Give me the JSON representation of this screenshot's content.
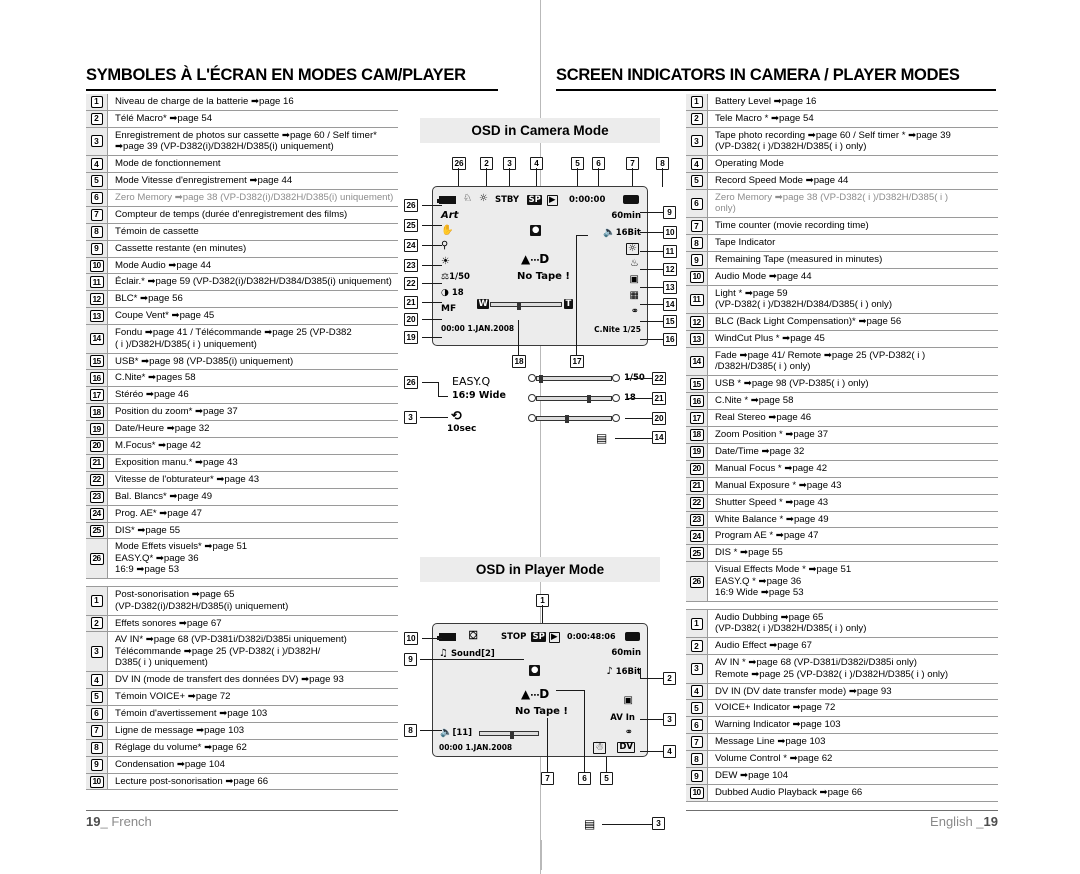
{
  "headers": {
    "french": "SYMBOLES À L'ÉCRAN EN MODES CAM/PLAYER",
    "english": "SCREEN INDICATORS IN CAMERA / PLAYER MODES"
  },
  "footer": {
    "french": "19_ French",
    "french_num": "19",
    "french_label": "French",
    "english": "English _19",
    "english_label": "English",
    "english_num": "19"
  },
  "osd_panels": {
    "camera_title": "OSD in Camera Mode",
    "player_title": "OSD in Player Mode"
  },
  "camera_osd": {
    "top_row": {
      "battery": "battery-icon",
      "tele_macro": "tele-macro-icon",
      "photo": "photo-icon",
      "mode": "STBY",
      "record_speed": "SP",
      "play": "play-icon",
      "counter": "0:00:00",
      "tape": "tape-icon"
    },
    "left_side": [
      {
        "num": "26",
        "label": "Art"
      },
      {
        "num": "25",
        "label": "dis-hand-icon"
      },
      {
        "num": "24",
        "label": "program-ae-icon"
      },
      {
        "num": "23",
        "label": "white-balance-icon"
      },
      {
        "num": "22",
        "label": "1/50"
      },
      {
        "num": "21",
        "label": "18"
      },
      {
        "num": "20",
        "label": "MF"
      },
      {
        "num": "19",
        "label": "00:00  1.JAN.2008"
      }
    ],
    "right_side": [
      {
        "num": "9",
        "label": "60min"
      },
      {
        "num": "10",
        "label": "16Bit"
      },
      {
        "num": "11",
        "label": "blc-icon"
      },
      {
        "num": "12",
        "label": "windcut-icon"
      },
      {
        "num": "13",
        "label": "fade-icon"
      },
      {
        "num": "14",
        "label": "light-icon"
      },
      {
        "num": "15",
        "label": "usb-icon"
      },
      {
        "num": "16",
        "label": "C.Nite 1/25"
      }
    ],
    "center": {
      "rec_dot": "rec-icon",
      "eject": "eject-icon",
      "dv": "D",
      "no_tape": "No Tape !"
    },
    "zoom_bar": {
      "wide": "W",
      "tele": "T",
      "num": "18"
    },
    "volume_callout": "17"
  },
  "camera_extra": {
    "easyq_num": "26",
    "easyq": "EASY.Q",
    "wide": "16:9 Wide",
    "selftimer_num": "3",
    "selftimer": "10sec",
    "sliders": [
      {
        "num": "22",
        "value": "1/50"
      },
      {
        "num": "21",
        "value": "18"
      },
      {
        "num": "20",
        "value": ""
      }
    ],
    "light_num": "14"
  },
  "player_osd": {
    "top_row": {
      "battery": "battery-icon",
      "voice_plus": "voice-plus-icon",
      "mode": "STOP",
      "record_speed": "SP",
      "play": "play-icon",
      "counter": "0:00:48:06",
      "tape": "tape-icon"
    },
    "sound": "Sound[2]",
    "sound_num": "10",
    "rec_num": "9",
    "remaining": "60min",
    "audio_bit": "16Bit",
    "audio_bit_num": "2",
    "eject": "eject-icon",
    "dv": "D",
    "dv_num": "6",
    "no_tape": "No Tape !",
    "no_tape_num": "7",
    "fade_icon": "fade-icon",
    "av_in": "AV In",
    "av_in_num": "3",
    "usb_icon": "usb-icon",
    "dew_icon": "dew-icon",
    "dew_num": "5",
    "dv_in": "DV",
    "dv_in_num": "4",
    "volume": "[11]",
    "volume_num": "8",
    "datetime": "00:00  1.JAN.2008",
    "voice_num": "1",
    "light_icon_num": "3"
  },
  "french_list_camera": [
    {
      "num": "1",
      "text": "Niveau de charge de la batterie ➡page 16"
    },
    {
      "num": "2",
      "text": "Télé Macro* ➡page 54"
    },
    {
      "num": "3",
      "text": "Enregistrement de photos sur cassette ➡page 60 / Self timer*",
      "text2": "➡page 39 (VP-D382(i)/D382H/D385(i) uniquement)"
    },
    {
      "num": "4",
      "text": "Mode de fonctionnement"
    },
    {
      "num": "5",
      "text": "Mode Vitesse d'enregistrement ➡page 44"
    },
    {
      "num": "6",
      "text": "Zero Memory ➡page 38 (VP-D382(i)/D382H/D385(i) uniquement)",
      "dim": true
    },
    {
      "num": "7",
      "text": "Compteur de temps (durée d'enregistrement des films)"
    },
    {
      "num": "8",
      "text": "Témoin de cassette"
    },
    {
      "num": "9",
      "text": "Cassette restante (en minutes)"
    },
    {
      "num": "10",
      "text": "Mode Audio ➡page 44"
    },
    {
      "num": "11",
      "text": "Éclair.* ➡page 59  (VP-D382(i)/D382H/D384/D385(i) uniquement)"
    },
    {
      "num": "12",
      "text": "BLC* ➡page 56"
    },
    {
      "num": "13",
      "text": "Coupe Vent* ➡page 45"
    },
    {
      "num": "14",
      "text": "Fondu ➡page 41 / Télécommande ➡page 25 (VP-D382",
      "text2": "( i )/D382H/D385( i )  uniquement)"
    },
    {
      "num": "15",
      "text": "USB* ➡page 98 (VP-D385(i) uniquement)"
    },
    {
      "num": "16",
      "text": "C.Nite* ➡pages 58"
    },
    {
      "num": "17",
      "text": "Stéréo ➡page 46"
    },
    {
      "num": "18",
      "text": "Position du zoom* ➡page 37"
    },
    {
      "num": "19",
      "text": "Date/Heure ➡page 32"
    },
    {
      "num": "20",
      "text": "M.Focus* ➡page 42"
    },
    {
      "num": "21",
      "text": "Exposition manu.* ➡page 43"
    },
    {
      "num": "22",
      "text": "Vitesse de l'obturateur* ➡page 43"
    },
    {
      "num": "23",
      "text": "Bal. Blancs* ➡page 49"
    },
    {
      "num": "24",
      "text": "Prog. AE* ➡page 47"
    },
    {
      "num": "25",
      "text": "DIS* ➡page 55"
    },
    {
      "num": "26",
      "text": "Mode Effets visuels* ➡page 51",
      "text2": "EASY.Q* ➡page 36",
      "text3": "16:9 ➡page 53"
    }
  ],
  "french_list_player": [
    {
      "num": "1",
      "text": "Post-sonorisation ➡page 65",
      "text2": "(VP-D382(i)/D382H/D385(i) uniquement)"
    },
    {
      "num": "2",
      "text": "Effets sonores ➡page 67"
    },
    {
      "num": "3",
      "text": "AV IN* ➡page 68 (VP-D381i/D382i/D385i uniquement)",
      "text2": "Télécommande ➡page 25 (VP-D382( i )/D382H/",
      "text3": "D385( i )  uniquement)"
    },
    {
      "num": "4",
      "text": "DV IN (mode de transfert des données DV) ➡page 93"
    },
    {
      "num": "5",
      "text": "Témoin VOICE+ ➡page 72"
    },
    {
      "num": "6",
      "text": "Témoin d'avertissement ➡page 103"
    },
    {
      "num": "7",
      "text": "Ligne de message ➡page 103"
    },
    {
      "num": "8",
      "text": "Réglage du volume* ➡page 62"
    },
    {
      "num": "9",
      "text": "Condensation ➡page 104"
    },
    {
      "num": "10",
      "text": "Lecture post-sonorisation ➡page 66"
    }
  ],
  "english_list_camera": [
    {
      "num": "1",
      "text": "Battery Level ➡page 16"
    },
    {
      "num": "2",
      "text": "Tele Macro * ➡page 54"
    },
    {
      "num": "3",
      "text": "Tape photo recording ➡page 60 / Self timer * ➡page 39",
      "text2": "(VP-D382( i )/D382H/D385( i ) only)"
    },
    {
      "num": "4",
      "text": "Operating Mode"
    },
    {
      "num": "5",
      "text": "Record Speed Mode ➡page 44"
    },
    {
      "num": "6",
      "text": "Zero Memory ➡page 38 (VP-D382( i )/D382H/D385( i )",
      "text2": "only)",
      "dim": true
    },
    {
      "num": "7",
      "text": "Time counter (movie recording time)"
    },
    {
      "num": "8",
      "text": "Tape Indicator"
    },
    {
      "num": "9",
      "text": "Remaining Tape (measured in minutes)"
    },
    {
      "num": "10",
      "text": "Audio Mode ➡page 44"
    },
    {
      "num": "11",
      "text": "Light * ➡page 59",
      "text2": "(VP-D382( i )/D382H/D384/D385( i ) only)"
    },
    {
      "num": "12",
      "text": "BLC (Back Light Compensation)* ➡page 56"
    },
    {
      "num": "13",
      "text": "WindCut Plus * ➡page 45"
    },
    {
      "num": "14",
      "text": "Fade ➡page 41/ Remote ➡page 25 (VP-D382( i )",
      "text2": "/D382H/D385( i ) only)"
    },
    {
      "num": "15",
      "text": "USB * ➡page 98 (VP-D385( i ) only)"
    },
    {
      "num": "16",
      "text": "C.Nite * ➡page 58"
    },
    {
      "num": "17",
      "text": "Real Stereo ➡page 46"
    },
    {
      "num": "18",
      "text": "Zoom Position * ➡page 37"
    },
    {
      "num": "19",
      "text": "Date/Time  ➡page 32"
    },
    {
      "num": "20",
      "text": "Manual Focus * ➡page 42"
    },
    {
      "num": "21",
      "text": "Manual Exposure * ➡page 43"
    },
    {
      "num": "22",
      "text": "Shutter Speed * ➡page 43"
    },
    {
      "num": "23",
      "text": "White Balance * ➡page 49"
    },
    {
      "num": "24",
      "text": "Program AE * ➡page 47"
    },
    {
      "num": "25",
      "text": "DIS * ➡page 55"
    },
    {
      "num": "26",
      "text": "Visual Effects Mode * ➡page 51",
      "text2": "EASY.Q * ➡page 36",
      "text3": "16:9 Wide ➡page 53"
    }
  ],
  "english_list_player": [
    {
      "num": "1",
      "text": "Audio Dubbing ➡page 65",
      "text2": "(VP-D382( i )/D382H/D385( i ) only)"
    },
    {
      "num": "2",
      "text": "Audio Effect ➡page 67"
    },
    {
      "num": "3",
      "text": "AV IN * ➡page 68 (VP-D381i/D382i/D385i only)",
      "text2": "Remote ➡page 25 (VP-D382( i )/D382H/D385( i ) only)"
    },
    {
      "num": "4",
      "text": "DV IN (DV date transfer mode) ➡page 93"
    },
    {
      "num": "5",
      "text": "VOICE+ Indicator ➡page 72"
    },
    {
      "num": "6",
      "text": "Warning Indicator ➡page 103"
    },
    {
      "num": "7",
      "text": "Message Line ➡page 103"
    },
    {
      "num": "8",
      "text": "Volume Control * ➡page 62"
    },
    {
      "num": "9",
      "text": "DEW ➡page 104"
    },
    {
      "num": "10",
      "text": "Dubbed Audio Playback ➡page 66"
    }
  ]
}
